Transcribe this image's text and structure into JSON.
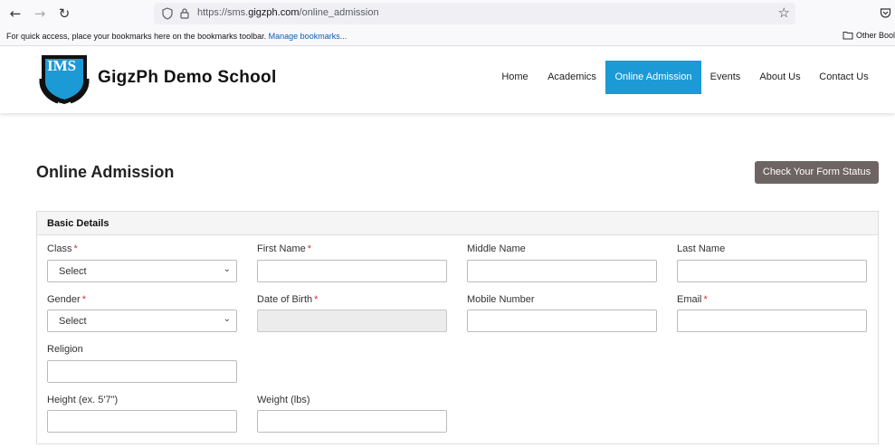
{
  "browser": {
    "url_prefix": "https://sms.",
    "url_host": "gigzph.com",
    "url_path": "/online_admission",
    "bookmarks_hint": "For quick access, place your bookmarks here on the bookmarks toolbar.",
    "manage_bookmarks": "Manage bookmarks...",
    "other_bookmarks": "Other Bool"
  },
  "header": {
    "school_name": "GigzPh Demo School",
    "logo_text": "IMS",
    "logo_year": "2016",
    "nav": [
      {
        "label": "Home"
      },
      {
        "label": "Academics"
      },
      {
        "label": "Online Admission",
        "active": true
      },
      {
        "label": "Events"
      },
      {
        "label": "About Us"
      },
      {
        "label": "Contact Us"
      }
    ]
  },
  "main": {
    "title": "Online Admission",
    "status_button": "Check Your Form Status",
    "panel_title": "Basic Details",
    "fields": {
      "class": {
        "label": "Class",
        "value": "Select"
      },
      "first_name": {
        "label": "First Name"
      },
      "middle_name": {
        "label": "Middle Name"
      },
      "last_name": {
        "label": "Last Name"
      },
      "gender": {
        "label": "Gender",
        "value": "Select"
      },
      "dob": {
        "label": "Date of Birth"
      },
      "mobile": {
        "label": "Mobile Number"
      },
      "email": {
        "label": "Email"
      },
      "religion": {
        "label": "Religion"
      },
      "height": {
        "label": "Height (ex. 5'7\")"
      },
      "weight": {
        "label": "Weight (lbs)"
      }
    },
    "required_mark": "*"
  },
  "colors": {
    "accent": "#1c9ad6",
    "status_button": "#6d6463",
    "required": "#d9302c"
  }
}
